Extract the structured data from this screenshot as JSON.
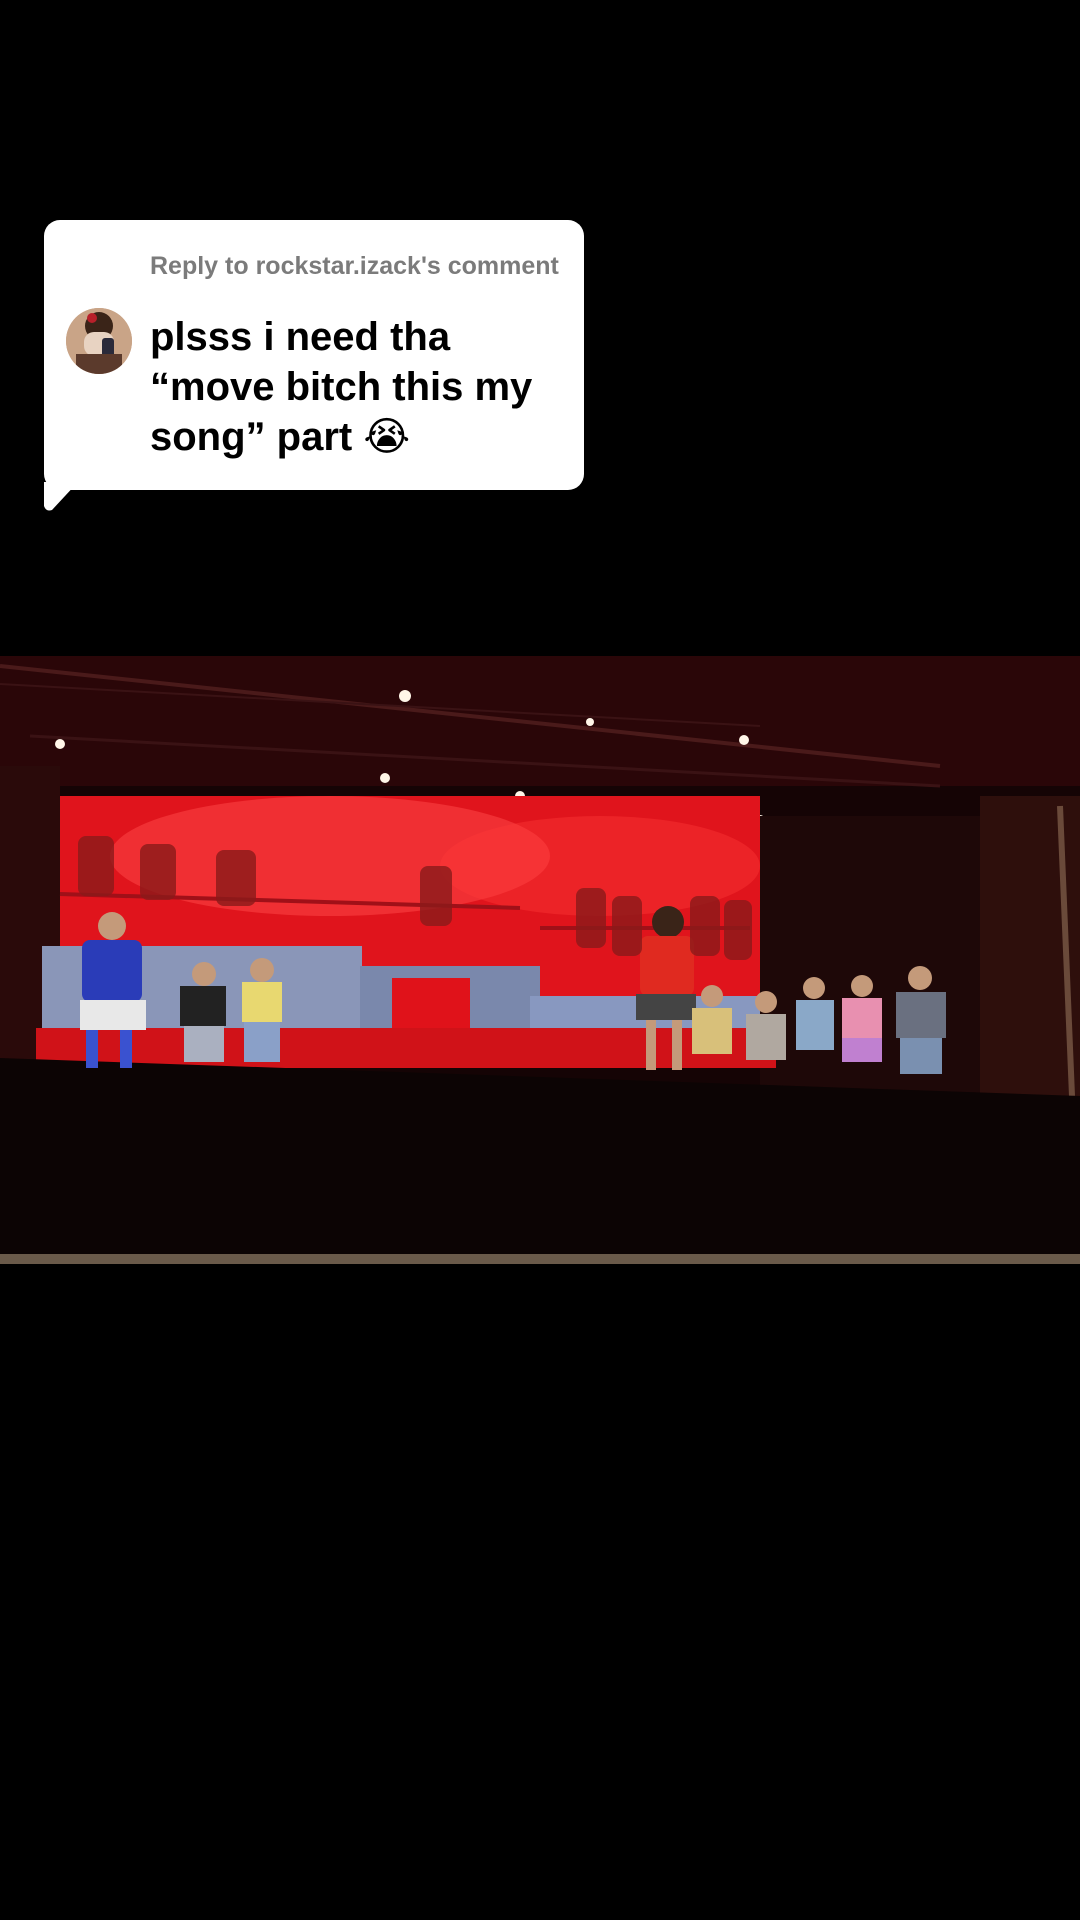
{
  "reply": {
    "header": "Reply to rockstar.izack's comment",
    "comment_text": "plsss i need tha “move bitch this my song” part",
    "emoji": "😭",
    "avatar_icon": "user-avatar"
  },
  "video": {
    "subject": "stage-performance",
    "colors": {
      "stage_backdrop": "#e0141c",
      "curtain": "#2a0a0a",
      "floor": "#0c0404"
    }
  }
}
